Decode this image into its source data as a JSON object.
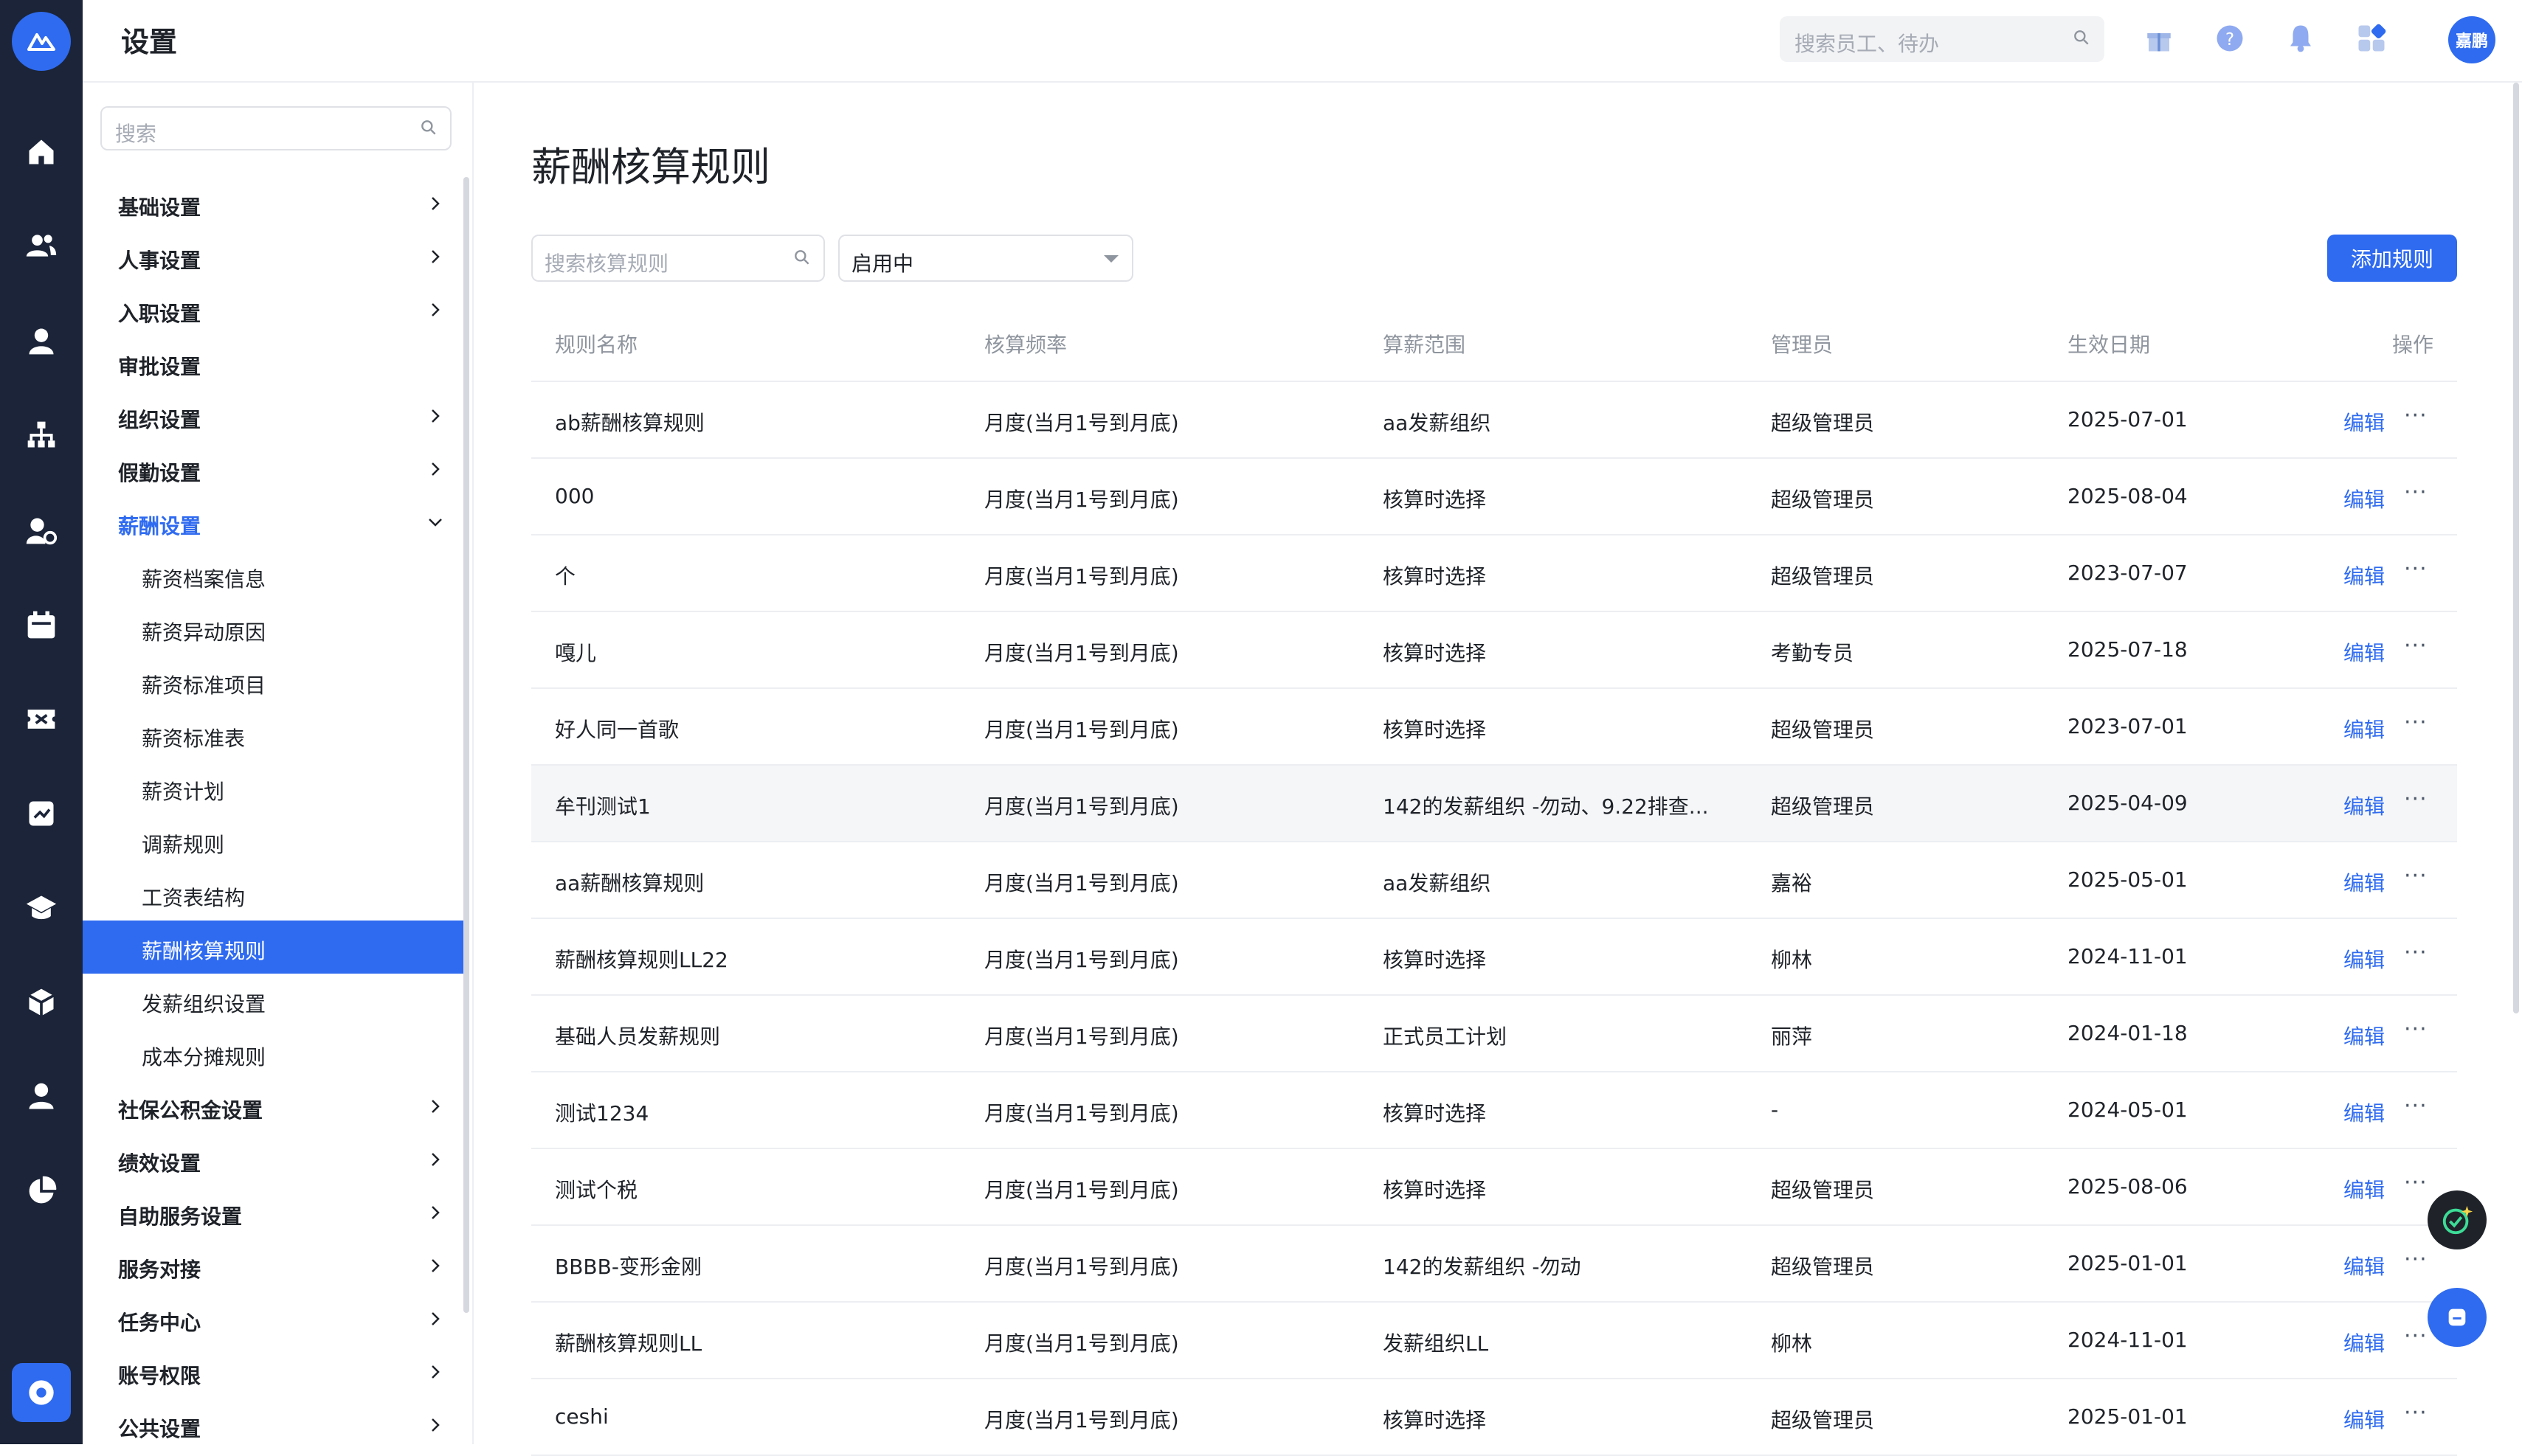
{
  "header": {
    "title": "设置",
    "search_placeholder": "搜索员工、待办",
    "avatar_text": "嘉鹏"
  },
  "sidebar": {
    "search_placeholder": "搜索",
    "items": [
      {
        "label": "基础设置"
      },
      {
        "label": "人事设置"
      },
      {
        "label": "入职设置"
      },
      {
        "label": "审批设置"
      },
      {
        "label": "组织设置"
      },
      {
        "label": "假勤设置"
      },
      {
        "label": "薪酬设置"
      },
      {
        "label": "社保公积金设置"
      },
      {
        "label": "绩效设置"
      },
      {
        "label": "自助服务设置"
      },
      {
        "label": "服务对接"
      },
      {
        "label": "任务中心"
      },
      {
        "label": "账号权限"
      },
      {
        "label": "公共设置"
      }
    ],
    "sub_items": [
      {
        "label": "薪资档案信息"
      },
      {
        "label": "薪资异动原因"
      },
      {
        "label": "薪资标准项目"
      },
      {
        "label": "薪资标准表"
      },
      {
        "label": "薪资计划"
      },
      {
        "label": "调薪规则"
      },
      {
        "label": "工资表结构"
      },
      {
        "label": "薪酬核算规则"
      },
      {
        "label": "发薪组织设置"
      },
      {
        "label": "成本分摊规则"
      }
    ]
  },
  "main": {
    "title": "薪酬核算规则",
    "search_placeholder": "搜索核算规则",
    "status_value": "启用中",
    "add_button": "添加规则",
    "columns": [
      "规则名称",
      "核算频率",
      "算薪范围",
      "管理员",
      "生效日期",
      "操作"
    ],
    "edit_label": "编辑",
    "more_label": "···",
    "rows": [
      {
        "name": "ab薪酬核算规则",
        "freq": "月度(当月1号到月底)",
        "scope": "aa发薪组织",
        "admin": "超级管理员",
        "date": "2025-07-01"
      },
      {
        "name": "000",
        "freq": "月度(当月1号到月底)",
        "scope": "核算时选择",
        "admin": "超级管理员",
        "date": "2025-08-04"
      },
      {
        "name": "个",
        "freq": "月度(当月1号到月底)",
        "scope": "核算时选择",
        "admin": "超级管理员",
        "date": "2023-07-07"
      },
      {
        "name": "嘎儿",
        "freq": "月度(当月1号到月底)",
        "scope": "核算时选择",
        "admin": "考勤专员",
        "date": "2025-07-18"
      },
      {
        "name": "好人同一首歌",
        "freq": "月度(当月1号到月底)",
        "scope": "核算时选择",
        "admin": "超级管理员",
        "date": "2023-07-01"
      },
      {
        "name": "牟刊测试1",
        "freq": "月度(当月1号到月底)",
        "scope": "142的发薪组织 -勿动、9.22排查...",
        "admin": "超级管理员",
        "date": "2025-04-09"
      },
      {
        "name": "aa薪酬核算规则",
        "freq": "月度(当月1号到月底)",
        "scope": "aa发薪组织",
        "admin": "嘉裕",
        "date": "2025-05-01"
      },
      {
        "name": "薪酬核算规则LL22",
        "freq": "月度(当月1号到月底)",
        "scope": "核算时选择",
        "admin": "柳林",
        "date": "2024-11-01"
      },
      {
        "name": "基础人员发薪规则",
        "freq": "月度(当月1号到月底)",
        "scope": "正式员工计划",
        "admin": "丽萍",
        "date": "2024-01-18"
      },
      {
        "name": "测试1234",
        "freq": "月度(当月1号到月底)",
        "scope": "核算时选择",
        "admin": "-",
        "date": "2024-05-01"
      },
      {
        "name": "测试个税",
        "freq": "月度(当月1号到月底)",
        "scope": "核算时选择",
        "admin": "超级管理员",
        "date": "2025-08-06"
      },
      {
        "name": "BBBB-变形金刚",
        "freq": "月度(当月1号到月底)",
        "scope": "142的发薪组织 -勿动",
        "admin": "超级管理员",
        "date": "2025-01-01"
      },
      {
        "name": "薪酬核算规则LL",
        "freq": "月度(当月1号到月底)",
        "scope": "发薪组织LL",
        "admin": "柳林",
        "date": "2024-11-01"
      },
      {
        "name": "ceshi",
        "freq": "月度(当月1号到月底)",
        "scope": "核算时选择",
        "admin": "超级管理员",
        "date": "2025-01-01"
      }
    ]
  },
  "colors": {
    "accent": "#2f6bf0",
    "rail": "#1b2438"
  }
}
